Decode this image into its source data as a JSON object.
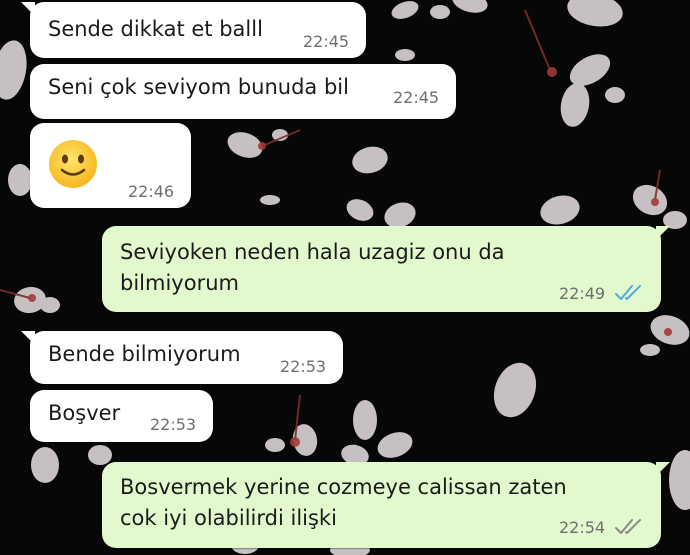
{
  "colors": {
    "incoming_bubble": "#ffffff",
    "outgoing_bubble": "#e2f9cd",
    "read_ticks": "#4fa9e6",
    "sent_ticks": "#8a8a8a",
    "wallpaper": "#070707"
  },
  "messages": [
    {
      "direction": "incoming",
      "text": "Sende dikkat et balll",
      "time": "22:45"
    },
    {
      "direction": "incoming",
      "text": "Seni çok seviyom bunuda bil",
      "time": "22:45"
    },
    {
      "direction": "incoming",
      "emoji": "slightly-smiling-face-icon",
      "time": "22:46"
    },
    {
      "direction": "outgoing",
      "text_line1": "Seviyoken neden hala uzagiz onu da",
      "text_line2": "bilmiyorum",
      "time": "22:49",
      "status": "read"
    },
    {
      "direction": "incoming",
      "text": "Bende bilmiyorum",
      "time": "22:53"
    },
    {
      "direction": "incoming",
      "text": "Boşver",
      "time": "22:53"
    },
    {
      "direction": "outgoing",
      "text_line1": "Bosvermek yerine cozmeye calissan zaten",
      "text_line2": "cok iyi olabilirdi ilişki",
      "time": "22:54",
      "status": "delivered"
    }
  ]
}
